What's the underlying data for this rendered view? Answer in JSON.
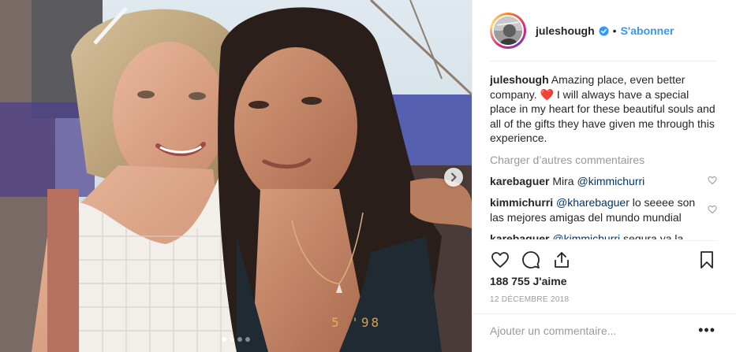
{
  "header": {
    "username": "juleshough",
    "bullet": "•",
    "follow_label": "S'abonner"
  },
  "caption": {
    "username": "juleshough",
    "text_before": "Amazing place, even better company.",
    "emoji": "❤️",
    "text_after": "I will always have a special place in my heart for these beautiful souls and all of the gifts they have given me through this experience."
  },
  "load_more_label": "Charger d’autres commentaires",
  "comments": [
    {
      "username": "karebaguer",
      "text": "Mira",
      "mention": "@kimmichurri",
      "text_after": ""
    },
    {
      "username": "kimmichurri",
      "text": "",
      "mention": "@kharebaguer",
      "text_after": "lo seeee son las mejores amigas del mundo mundial"
    },
    {
      "username": "karebaguer",
      "text": "",
      "mention": "@kimmichurri",
      "text_after": "segura ya la"
    }
  ],
  "likes_label": "188 755 J'aime",
  "date_label": "12 DÉCEMBRE 2018",
  "add_comment_placeholder": "Ajouter un commentaire...",
  "more_label": "•••",
  "photo_stamp": "5 '98",
  "carousel": {
    "count": 4,
    "active_index": 0
  },
  "colors": {
    "accent": "#3897f0",
    "verified": "#3897f0",
    "heart": "#ed4956",
    "muted": "#999999"
  },
  "icons": [
    "heart-icon",
    "comment-icon",
    "share-icon",
    "bookmark-icon",
    "chevron-right-icon",
    "verified-badge-icon",
    "small-heart-icon"
  ]
}
